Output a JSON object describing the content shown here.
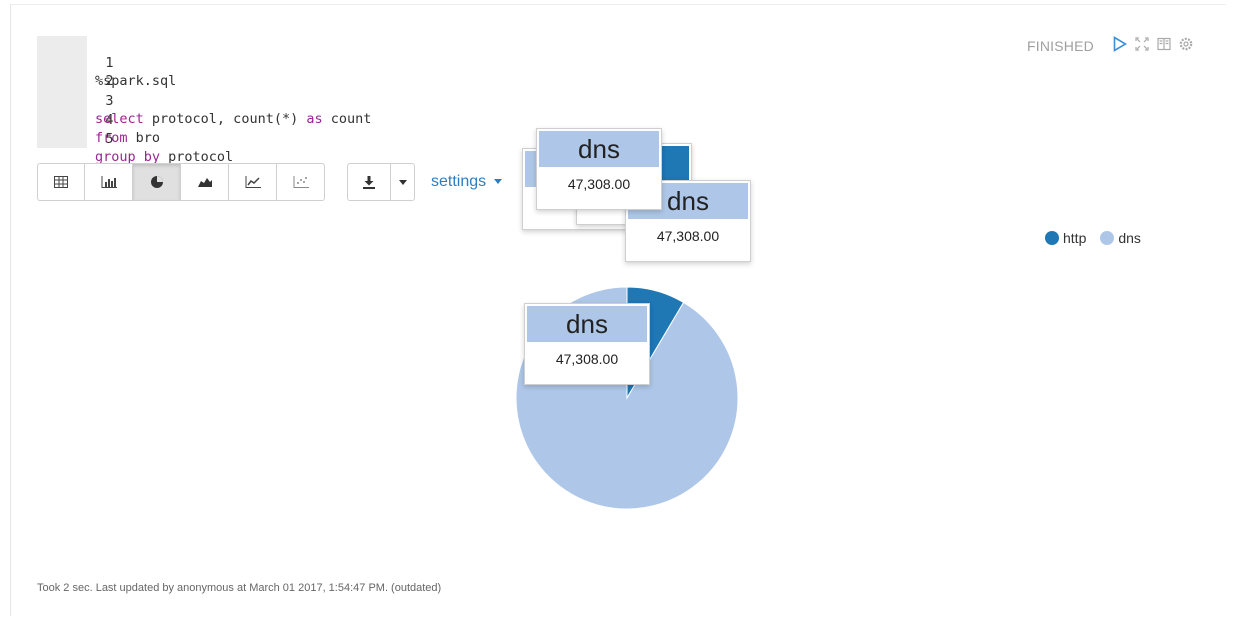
{
  "editor": {
    "lines": [
      {
        "num": "1",
        "text": "%spark.sql"
      },
      {
        "num": "2",
        "text": ""
      },
      {
        "num": "3",
        "kw1": "select",
        "mid": " protocol, count(*) ",
        "kw2": "as",
        "end": " count"
      },
      {
        "num": "4",
        "kw1": "from",
        "end": " bro"
      },
      {
        "num": "5",
        "kw1": "group by",
        "end": " protocol"
      }
    ]
  },
  "toolbar": {
    "buttons": [
      "table-icon",
      "bar-chart-icon",
      "pie-chart-icon",
      "area-chart-icon",
      "line-chart-icon",
      "scatter-chart-icon"
    ],
    "active": "pie-chart-icon",
    "settings_label": "settings"
  },
  "status": {
    "label": "FINISHED"
  },
  "legend": [
    {
      "label": "http",
      "color": "#1f77b4"
    },
    {
      "label": "dns",
      "color": "#aec7e8"
    }
  ],
  "tooltips": [
    {
      "title": "dns",
      "value": "47,308.00"
    },
    {
      "title": "dns",
      "value": "47,308.00"
    },
    {
      "title": "dns",
      "value": "47,308.00"
    },
    {
      "title": "dns",
      "value": "47,308.00"
    }
  ],
  "chart_data": {
    "type": "pie",
    "categories": [
      "http",
      "dns"
    ],
    "values": [
      4400,
      47308
    ],
    "colors": [
      "#1f77b4",
      "#aec7e8"
    ]
  },
  "footer": {
    "text": "Took 2 sec. Last updated by anonymous at March 01 2017, 1:54:47 PM. (outdated)"
  }
}
